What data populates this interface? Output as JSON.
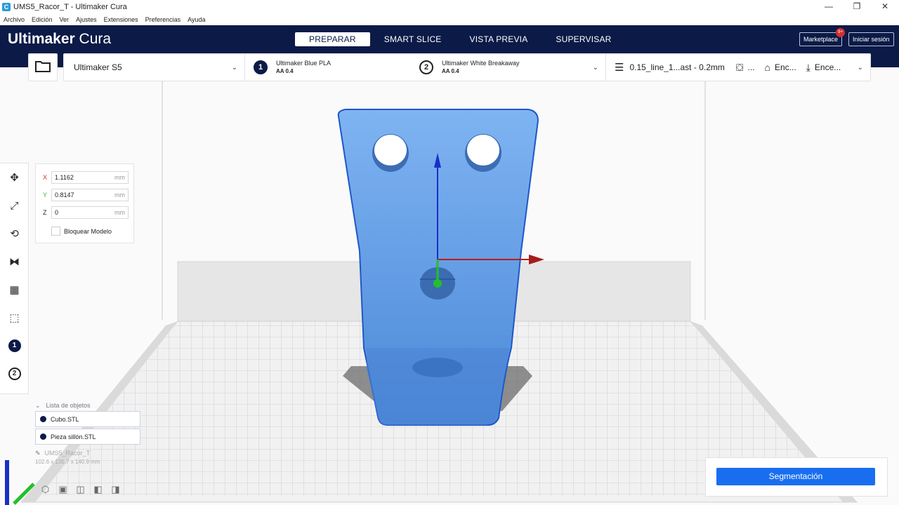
{
  "window": {
    "title": "UMS5_Racor_T - Ultimaker Cura",
    "controls": [
      "—",
      "❐",
      "✕"
    ]
  },
  "menu": [
    "Archivo",
    "Edición",
    "Ver",
    "Ajustes",
    "Extensiones",
    "Preferencias",
    "Ayuda"
  ],
  "header": {
    "logo_bold": "Ultimaker",
    "logo_rest": " Cura",
    "tabs": [
      "PREPARAR",
      "SMART SLICE",
      "VISTA PREVIA",
      "SUPERVISAR"
    ],
    "marketplace": "Marketplace",
    "marketplace_badge": "9+",
    "signin": "Iniciar sesión"
  },
  "config": {
    "printer": "Ultimaker S5",
    "extruder1": {
      "num": "1",
      "material": "Ultimaker Blue PLA",
      "nozzle": "AA 0.4"
    },
    "extruder2": {
      "num": "2",
      "material": "Ultimaker White Breakaway",
      "nozzle": "AA 0.4"
    },
    "profile": "0.15_line_1...ast - 0.2mm",
    "support": "...",
    "adhesion": "Enc...",
    "adhesion2": "Ence..."
  },
  "move_panel": {
    "x_label": "X",
    "x_value": "1.1162",
    "y_label": "Y",
    "y_value": "0.8147",
    "z_label": "Z",
    "z_value": "0",
    "unit": "mm",
    "lock_label": "Bloquear Modelo"
  },
  "object_list": {
    "title": "Lista de objetos",
    "items": [
      "Cubo.STL",
      "Pieza sillón.STL"
    ],
    "project_name": "UMS5_Racor_T",
    "dimensions": "102.6 x 135.7 x 140.9 mm"
  },
  "action": {
    "segment_button": "Segmentación"
  },
  "colors": {
    "header": "#0b1a47",
    "model": "#5b9be8",
    "accent": "#196ef0"
  }
}
